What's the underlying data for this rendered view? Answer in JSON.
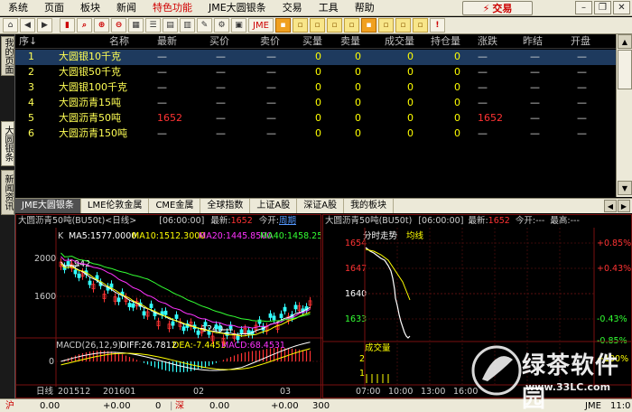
{
  "menu": {
    "items": [
      "系统",
      "页面",
      "板块",
      "新闻",
      "特色功能",
      "JME大圆银条",
      "交易",
      "工具",
      "帮助"
    ],
    "highlight_index": 4,
    "trade_button": "交易"
  },
  "toolbar": {
    "jme_label": "JME"
  },
  "side_tabs": [
    "我的页面",
    "大圆银条",
    "新闻资讯"
  ],
  "quote_table": {
    "columns": [
      "序↓",
      "名称",
      "最新",
      "买价",
      "卖价",
      "买量",
      "卖量",
      "成交量",
      "持仓量",
      "涨跌",
      "昨结",
      "开盘"
    ],
    "rows": [
      {
        "no": "1",
        "name": "大圆银10千克",
        "last": "—",
        "bid": "—",
        "ask": "—",
        "bidvol": "0",
        "askvol": "0",
        "vol": "0",
        "oi": "0",
        "chg": "—",
        "prev": "—",
        "open": "—"
      },
      {
        "no": "2",
        "name": "大圆银50千克",
        "last": "—",
        "bid": "—",
        "ask": "—",
        "bidvol": "0",
        "askvol": "0",
        "vol": "0",
        "oi": "0",
        "chg": "—",
        "prev": "—",
        "open": "—"
      },
      {
        "no": "3",
        "name": "大圆银100千克",
        "last": "—",
        "bid": "—",
        "ask": "—",
        "bidvol": "0",
        "askvol": "0",
        "vol": "0",
        "oi": "0",
        "chg": "—",
        "prev": "—",
        "open": "—"
      },
      {
        "no": "4",
        "name": "大圆沥青15吨",
        "last": "—",
        "bid": "—",
        "ask": "—",
        "bidvol": "0",
        "askvol": "0",
        "vol": "0",
        "oi": "0",
        "chg": "—",
        "prev": "—",
        "open": "—"
      },
      {
        "no": "5",
        "name": "大圆沥青50吨",
        "last": "1652",
        "bid": "—",
        "ask": "—",
        "bidvol": "0",
        "askvol": "0",
        "vol": "0",
        "oi": "0",
        "chg": "1652",
        "prev": "—",
        "open": "—"
      },
      {
        "no": "6",
        "name": "大圆沥青150吨",
        "last": "—",
        "bid": "—",
        "ask": "—",
        "bidvol": "0",
        "askvol": "0",
        "vol": "0",
        "oi": "0",
        "chg": "—",
        "prev": "—",
        "open": "—"
      }
    ]
  },
  "market_tabs": [
    "JME大圆银条",
    "LME伦敦金属",
    "CME金属",
    "全球指数",
    "上证A股",
    "深证A股",
    "我的板块"
  ],
  "kline": {
    "title": "大圆沥青50吨(BU50t)<日线>",
    "time": "[06:00:00]",
    "latest_label": "最新:",
    "latest_value": "1652",
    "open_label": "今开:",
    "period_link": "周期",
    "letter_k": "K",
    "ma5": "MA5:1577.0000",
    "ma10": "MA10:1512.3000",
    "ma20": "MA20:1445.8500",
    "ma40": "MA40:1458.250",
    "price_labels": [
      "2000",
      "1600"
    ],
    "annotation_high": "1942",
    "annotation_low": "1240",
    "macd": "MACD(26,12,9)",
    "diff": "DIFF:26.7812",
    "dea": "DEA:-7.4453",
    "macd_val": "MACD:68.4531",
    "macd_zero": "0",
    "xaxis": [
      "日线",
      "201512",
      "201601",
      "02",
      "03"
    ]
  },
  "intraday": {
    "title": "大圆沥青50吨(BU50t)",
    "time": "[06:00:00]",
    "latest_label": "最新:",
    "latest_value": "1652",
    "open_label": "今开:",
    "open_value": "---",
    "high_label": "最高:",
    "high_value": "---",
    "trend_label": "分时走势",
    "avg_label": "均线",
    "price_labels": [
      "1654",
      "1647",
      "1640",
      "1633"
    ],
    "pct_labels": [
      "+0.85%",
      "+0.43%",
      "-0.43%",
      "-0.85%"
    ],
    "vol_title": "成交量",
    "vol_labels": [
      "2",
      "1"
    ],
    "vol_pct": "+100%",
    "xaxis": [
      "07:00",
      "10:00",
      "13:00",
      "16:00"
    ]
  },
  "status_bar": {
    "sh_label": "沪",
    "sh_v1": "0.00",
    "sh_v2": "+0.00",
    "sh_v3": "0",
    "sz_label": "深",
    "sz_v1": "0.00",
    "sz_v2": "+0.00",
    "sz_v3": "300",
    "jme": "JME",
    "time": "11:0"
  },
  "watermark": {
    "text": "绿茶软件园",
    "url": "www.33LC.com"
  },
  "colors": {
    "positive": "#ff3333",
    "name_yellow": "#ffff55",
    "zero_yellow": "#ffff00",
    "grid_red": "#7a1010",
    "ma5": "#ffffff",
    "ma10": "#ffff00",
    "ma20": "#ff33ff",
    "ma40": "#33ff33"
  }
}
